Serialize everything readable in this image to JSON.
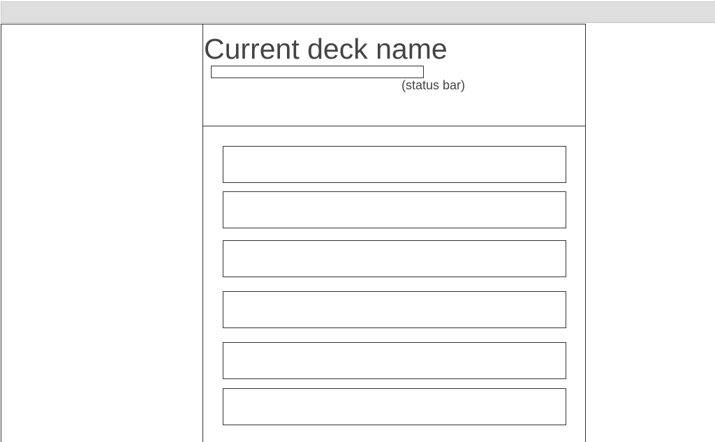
{
  "header": {
    "deck_name": "Current deck name",
    "status_label": "(status bar)"
  },
  "progress": {
    "fraction": 0
  },
  "card_list": {
    "slots": [
      "",
      "",
      "",
      "",
      "",
      ""
    ]
  }
}
